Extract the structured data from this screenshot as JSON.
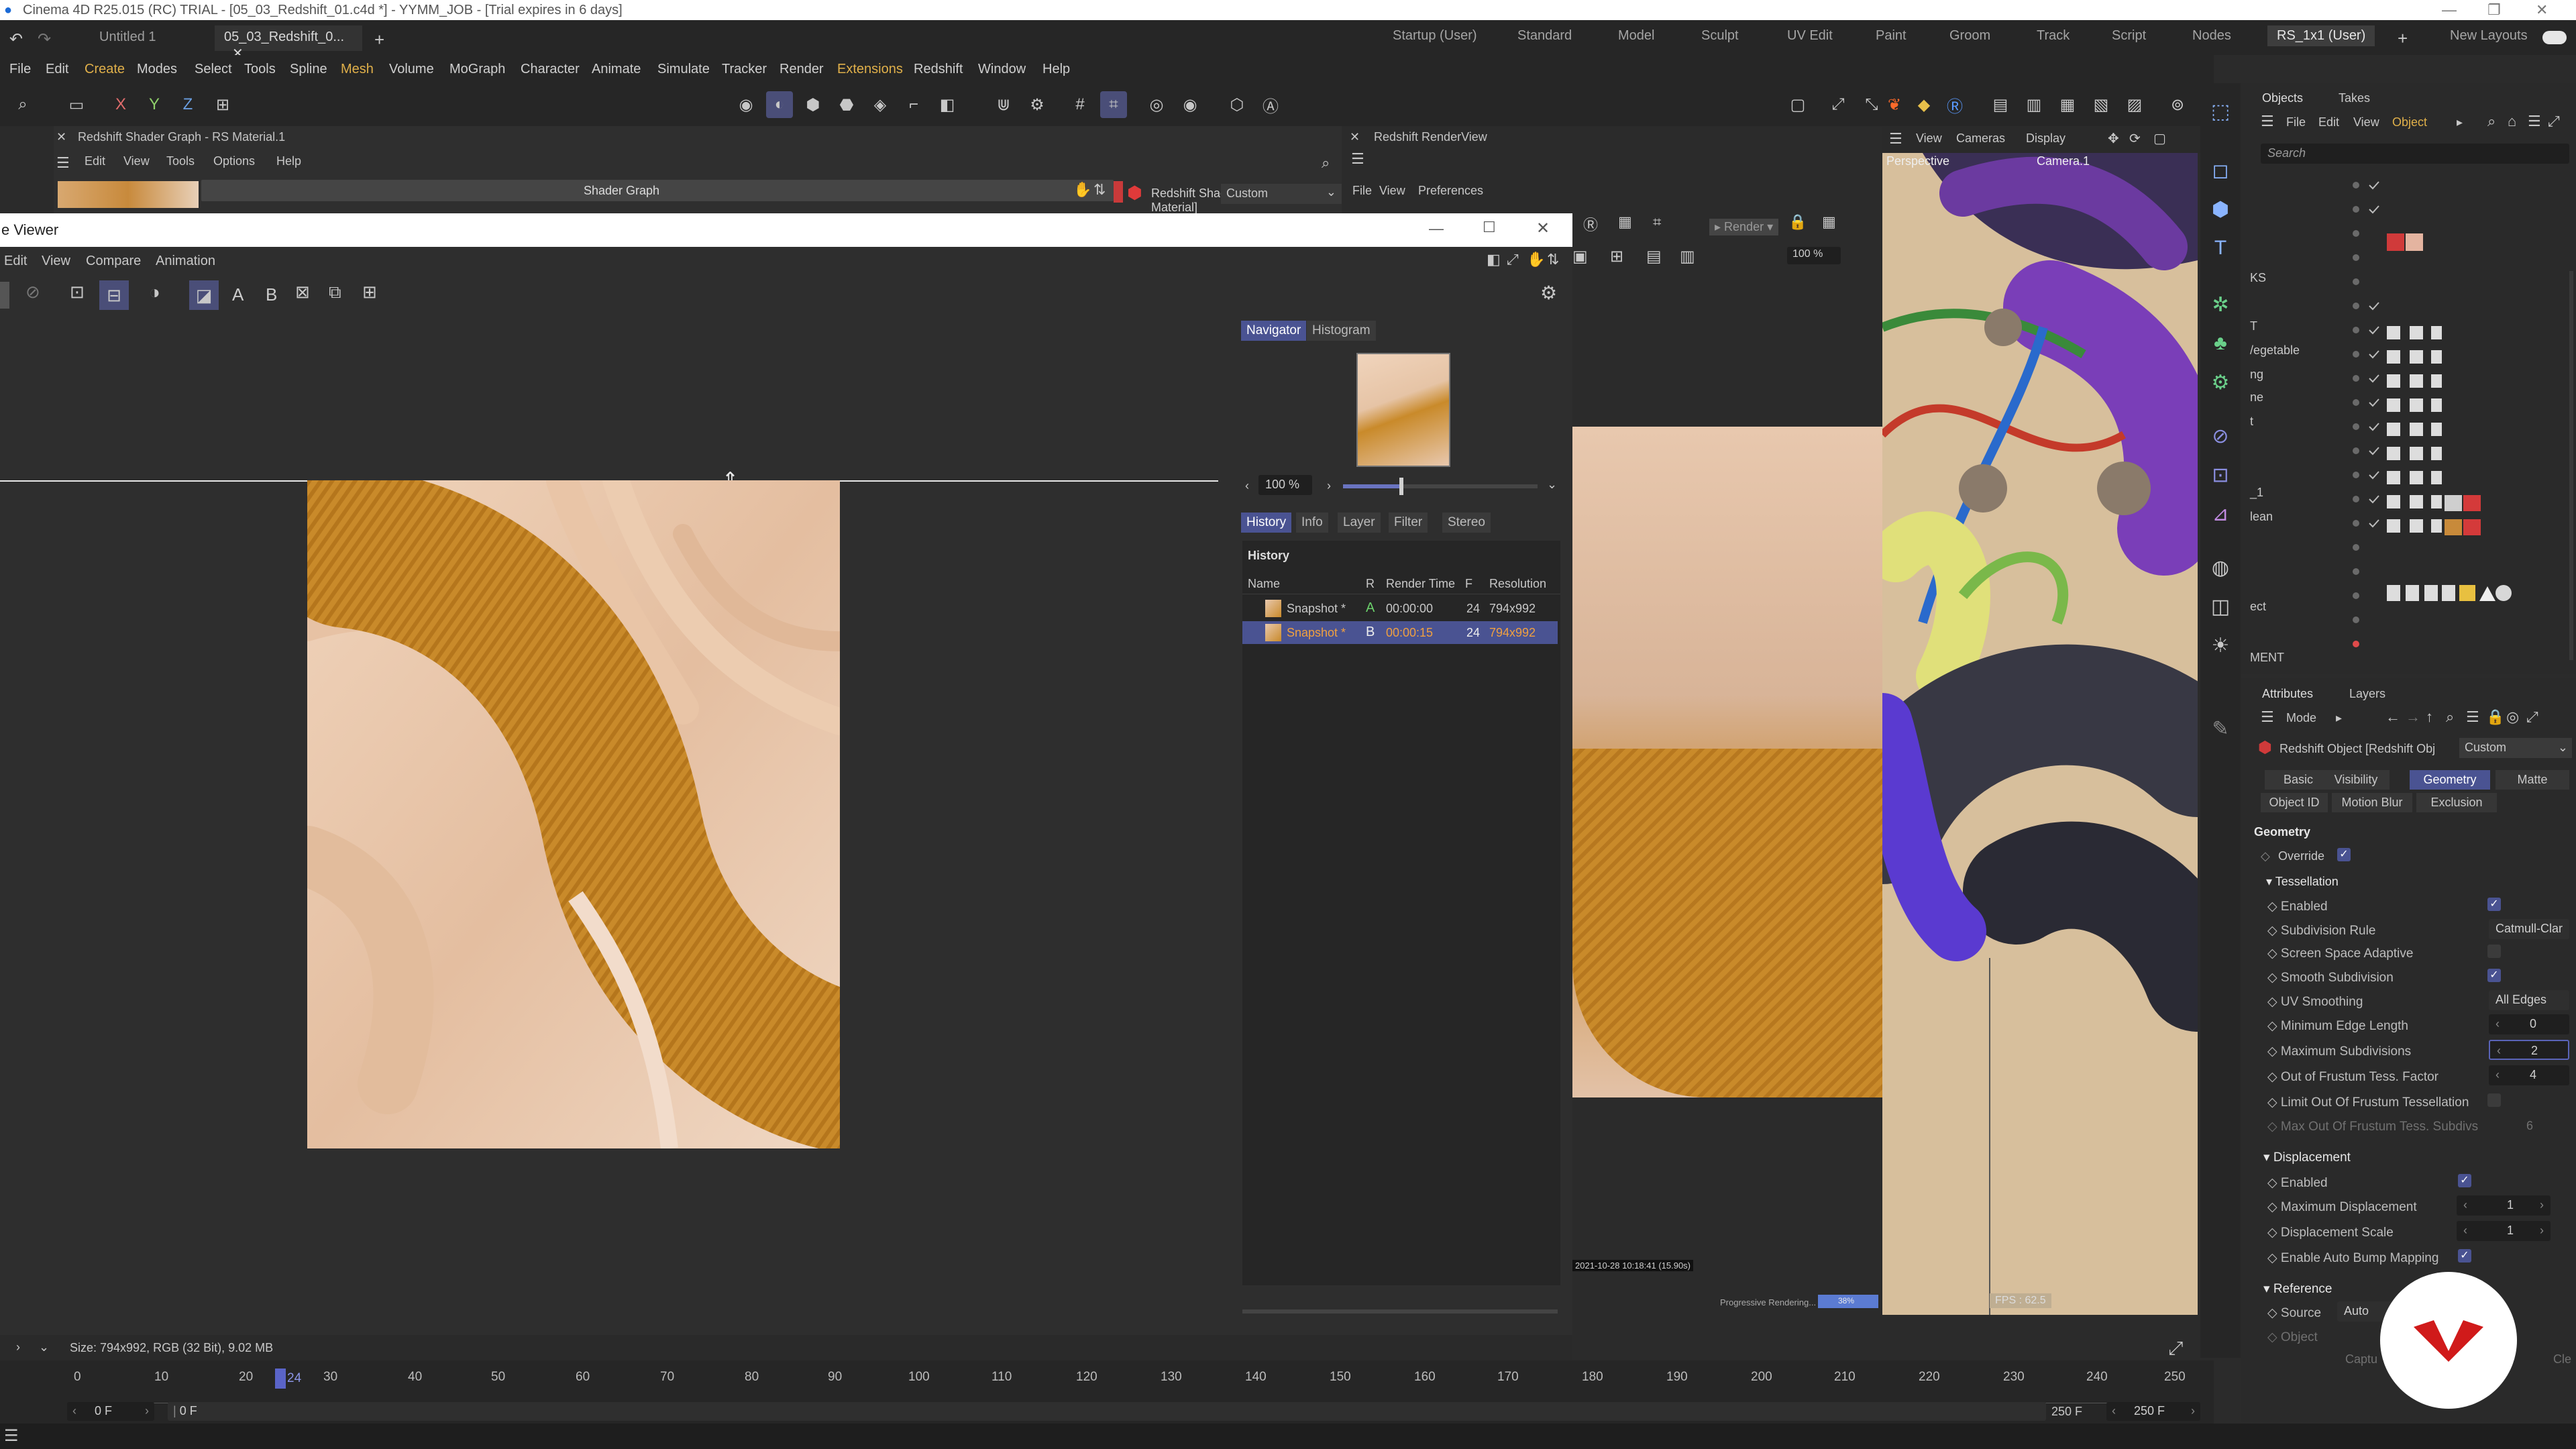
{
  "app": {
    "title": "Cinema 4D R25.015 (RC) TRIAL - [05_03_Redshift_01.c4d *] - YYMM_JOB - [Trial expires in 6 days]"
  },
  "doc_tabs": [
    {
      "label": "Untitled 1"
    },
    {
      "label": "05_03_Redshift_0..."
    }
  ],
  "layouts": [
    "Startup (User)",
    "Standard",
    "Model",
    "Sculpt",
    "UV Edit",
    "Paint",
    "Groom",
    "Track",
    "Script",
    "Nodes",
    "RS_1x1 (User)"
  ],
  "new_layouts": "New Layouts",
  "menu": [
    "File",
    "Edit",
    "Create",
    "Modes",
    "Select",
    "Tools",
    "Spline",
    "Mesh",
    "Volume",
    "MoGraph",
    "Character",
    "Animate",
    "Simulate",
    "Tracker",
    "Render",
    "Extensions",
    "Redshift",
    "Window",
    "Help"
  ],
  "axis": {
    "x": "X",
    "y": "Y",
    "z": "Z"
  },
  "shader_graph": {
    "title": "Redshift Shader Graph - RS Material.1",
    "menu": [
      "Edit",
      "View",
      "Tools",
      "Options",
      "Help"
    ],
    "header": "Shader Graph",
    "node_label": "Redshift Shader Node [RS Material]",
    "preset": "Custom"
  },
  "render_view": {
    "title": "Redshift RenderView",
    "menu": [
      "File",
      "View",
      "Preferences"
    ],
    "zoom": "100 %",
    "timestamp": "2021-10-28  10:18:41  (15.90s)",
    "progress_label": "Progressive Rendering...",
    "progress_pct": "38%"
  },
  "viewport": {
    "menu": [
      "View",
      "Cameras",
      "Display"
    ],
    "label": "Perspective",
    "camera": "Camera.1",
    "fps": "FPS : 62.5"
  },
  "picture_viewer": {
    "title": "e Viewer",
    "menu": [
      "Edit",
      "View",
      "Compare",
      "Animation"
    ],
    "nav_tabs": [
      "Navigator",
      "Histogram"
    ],
    "zoom": "100 %",
    "zoom_fraction": 0.3,
    "tabs": [
      "History",
      "Info",
      "Layer",
      "Filter",
      "Stereo"
    ],
    "history_title": "History",
    "columns": [
      "Name",
      "R",
      "Render Time",
      "F",
      "Resolution"
    ],
    "rows": [
      {
        "name": "Snapshot *",
        "r": "A",
        "time": "00:00:00",
        "f": "24",
        "res": "794x992"
      },
      {
        "name": "Snapshot *",
        "r": "B",
        "time": "00:00:15",
        "f": "24",
        "res": "794x992"
      }
    ],
    "status": "Size: 794x992, RGB (32 Bit), 9.02 MB",
    "ab_labels": [
      "A",
      "B"
    ]
  },
  "objects_panel": {
    "tabs": [
      "Objects",
      "Takes"
    ],
    "menu": [
      "File",
      "Edit",
      "View",
      "Object"
    ],
    "search_placeholder": "Search",
    "row_labels": [
      "KS",
      "T",
      "/egetable",
      "ng",
      "ne",
      "t",
      "_1",
      "lean",
      "ect",
      "MENT"
    ]
  },
  "attributes": {
    "tabs": [
      "Attributes",
      "Layers"
    ],
    "mode": "Mode",
    "object": "Redshift Object [Redshift Obj",
    "preset": "Custom",
    "subtabs": [
      "Basic",
      "Visibility",
      "Geometry",
      "Matte",
      "Object ID",
      "Motion Blur",
      "Exclusion"
    ],
    "section": "Geometry",
    "override": "Override",
    "tessellation": "Tessellation",
    "rows": [
      {
        "label": "Enabled",
        "value": "checked"
      },
      {
        "label": "Subdivision Rule",
        "value": "Catmull-Clar"
      },
      {
        "label": "Screen Space Adaptive",
        "value": "unchecked"
      },
      {
        "label": "Smooth Subdivision",
        "value": "checked"
      },
      {
        "label": "UV Smoothing",
        "value": "All Edges"
      },
      {
        "label": "Minimum Edge Length",
        "value": "0"
      },
      {
        "label": "Maximum Subdivisions",
        "value": "2"
      },
      {
        "label": "Out of Frustum Tess. Factor",
        "value": "4"
      },
      {
        "label": "Limit Out Of Frustum Tessellation",
        "value": "unchecked"
      },
      {
        "label": "Max Out Of Frustum Tess. Subdivs",
        "value": "6"
      }
    ],
    "displacement": "Displacement",
    "disp_rows": [
      {
        "label": "Enabled",
        "value": "checked"
      },
      {
        "label": "Maximum Displacement",
        "value": "1"
      },
      {
        "label": "Displacement Scale",
        "value": "1"
      },
      {
        "label": "Enable Auto Bump Mapping",
        "value": "checked"
      }
    ],
    "reference": "Reference",
    "source_label": "Source",
    "source_value": "Auto",
    "object_label": "Object",
    "capture_label": "Captu",
    "clear_label": "Cle"
  },
  "timeline": {
    "ticks": [
      "0",
      "10",
      "20",
      "30",
      "40",
      "50",
      "60",
      "70",
      "80",
      "90",
      "100",
      "110",
      "120",
      "130",
      "140",
      "150",
      "160",
      "170",
      "180",
      "190",
      "200",
      "210",
      "220",
      "230",
      "240",
      "250"
    ],
    "current": "24",
    "start_frame": "0 F",
    "start_frame2": "0 F",
    "end_frame": "250 F",
    "end_frame2": "250 F"
  },
  "colors": {
    "accent": "#4a5392",
    "menu_highlight": "#e0b04a",
    "render_orange": "#c98a2a",
    "skin": "#e8c8ae"
  }
}
